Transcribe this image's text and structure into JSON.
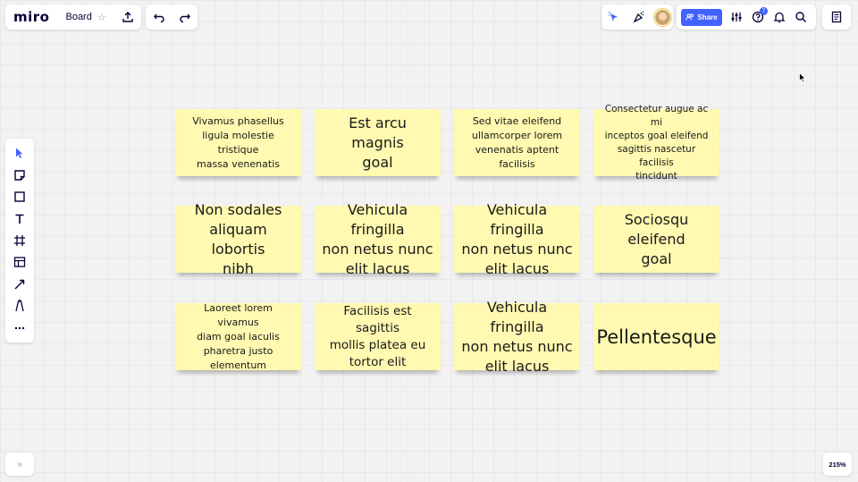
{
  "header": {
    "logo": "miro",
    "board_name": "Board",
    "share_label": "Share",
    "help_badge": "7"
  },
  "icons": {
    "upload": "upload-icon",
    "undo": "undo-icon",
    "redo": "redo-icon",
    "laser": "laser-pointer-icon",
    "celebrate": "confetti-icon",
    "settings": "sliders-icon",
    "help": "help-icon",
    "bell": "bell-icon",
    "search": "search-icon",
    "notes": "notes-icon"
  },
  "toolbar": {
    "tools": [
      "select",
      "sticky-note",
      "shape",
      "text",
      "frame",
      "template",
      "connection-line",
      "pen",
      "more"
    ]
  },
  "stickies": [
    {
      "text": "Vivamus phasellus\nligula molestie tristique\nmassa venenatis",
      "size": "s"
    },
    {
      "text": "Est arcu magnis\ngoal",
      "size": "l"
    },
    {
      "text": "Sed vitae eleifend\nullamcorper lorem\nvenenatis aptent\nfacilisis",
      "size": "s"
    },
    {
      "text": "Consectetur augue ac mi\ninceptos  goal eleifend\nsagittis nascetur facilisis\ntincidunt",
      "size": "xs"
    },
    {
      "text": "Non sodales\naliquam lobortis\nnibh",
      "size": "l"
    },
    {
      "text": "Vehicula fringilla\nnon netus nunc\nelit lacus",
      "size": "l"
    },
    {
      "text": "Vehicula fringilla\nnon netus nunc\nelit lacus",
      "size": "l"
    },
    {
      "text": "Sociosqu\neleifend\ngoal",
      "size": "l"
    },
    {
      "text": "Laoreet lorem vivamus\ndiam goal iaculis\npharetra justo\nelementum",
      "size": "s"
    },
    {
      "text": "Facilisis est sagittis\nmollis platea eu\ntortor elit",
      "size": "m"
    },
    {
      "text": "Vehicula fringilla\nnon netus nunc\nelit lacus",
      "size": "l"
    },
    {
      "text": "Pellentesque",
      "size": "xl"
    }
  ],
  "footer": {
    "expand": "»",
    "zoom": "215%"
  },
  "colors": {
    "sticky": "#fff9b1",
    "accent": "#4262ff",
    "canvas": "#f2f2f2"
  }
}
